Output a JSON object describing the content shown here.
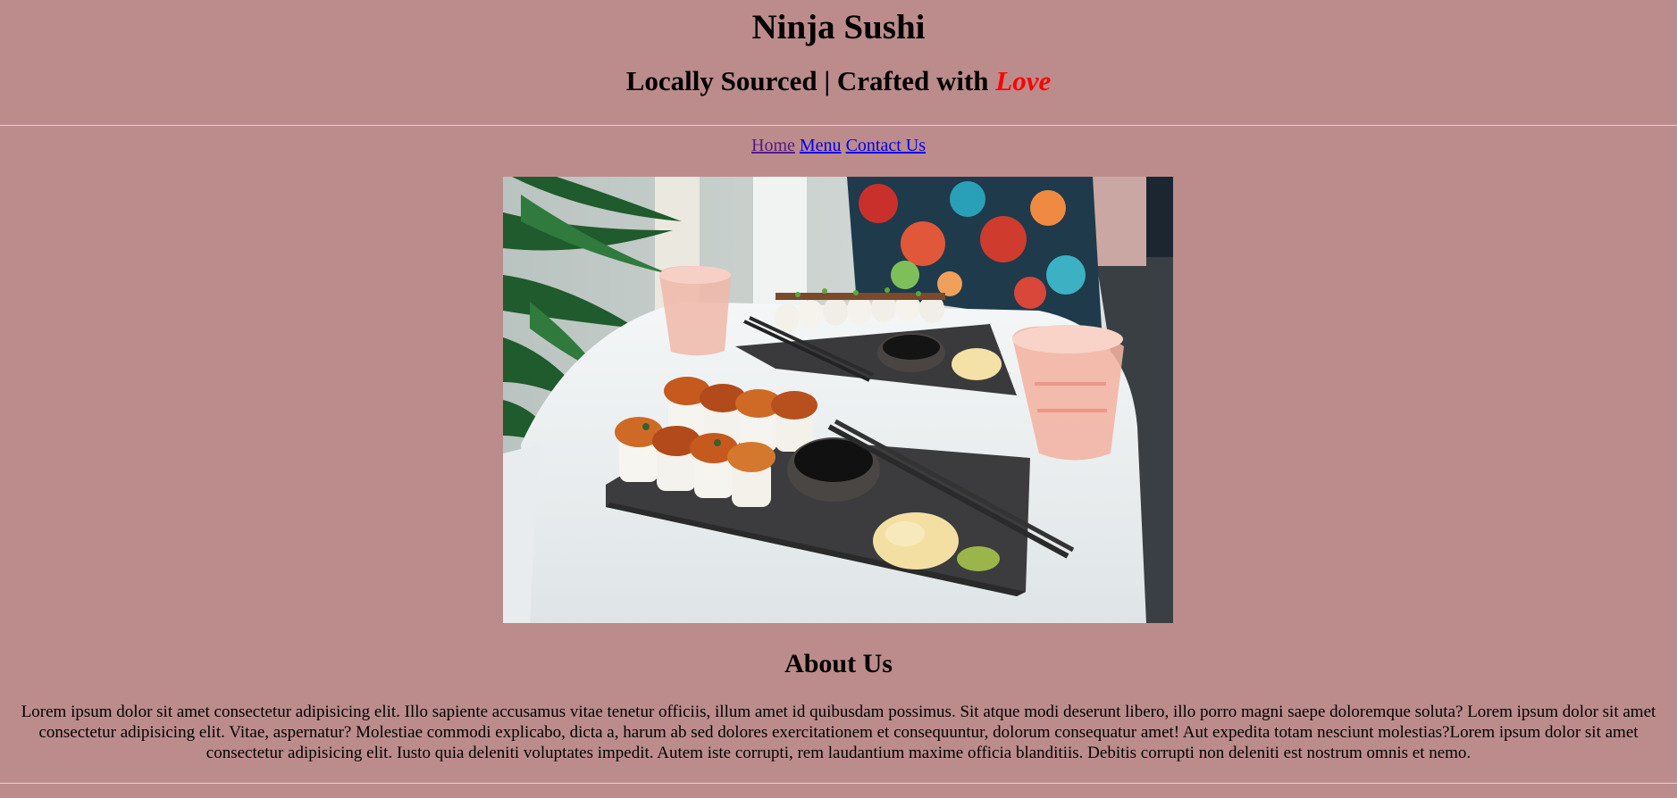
{
  "header": {
    "title": "Ninja Sushi",
    "tagline_prefix": "Locally Sourced | Crafted with ",
    "tagline_emphasis": "Love"
  },
  "nav": {
    "home": "Home",
    "menu": "Menu",
    "contact": "Contact Us"
  },
  "hero": {
    "subject": "sushi rolls on slate boards with soy sauce, chopsticks, ginger, wasabi and pink glasses"
  },
  "about": {
    "title": "About Us",
    "body": "Lorem ipsum dolor sit amet consectetur adipisicing elit. Illo sapiente accusamus vitae tenetur officiis, illum amet id quibusdam possimus. Sit atque modi deserunt libero, illo porro magni saepe doloremque soluta? Lorem ipsum dolor sit amet consectetur adipisicing elit. Vitae, aspernatur? Molestiae commodi explicabo, dicta a, harum ab sed dolores exercitationem et consequuntur, dolorum consequatur amet! Aut expedita totam nesciunt molestias?Lorem ipsum dolor sit amet consectetur adipisicing elit. Iusto quia deleniti voluptates impedit. Autem iste corrupti, rem laudantium maxime officia blanditiis. Debitis corrupti non deleniti est nostrum omnis et nemo."
  },
  "colors": {
    "page_background": "#bc8c8c",
    "accent_love": "#ff0000",
    "link": "#0000ee",
    "visited_link": "#551a8b"
  }
}
